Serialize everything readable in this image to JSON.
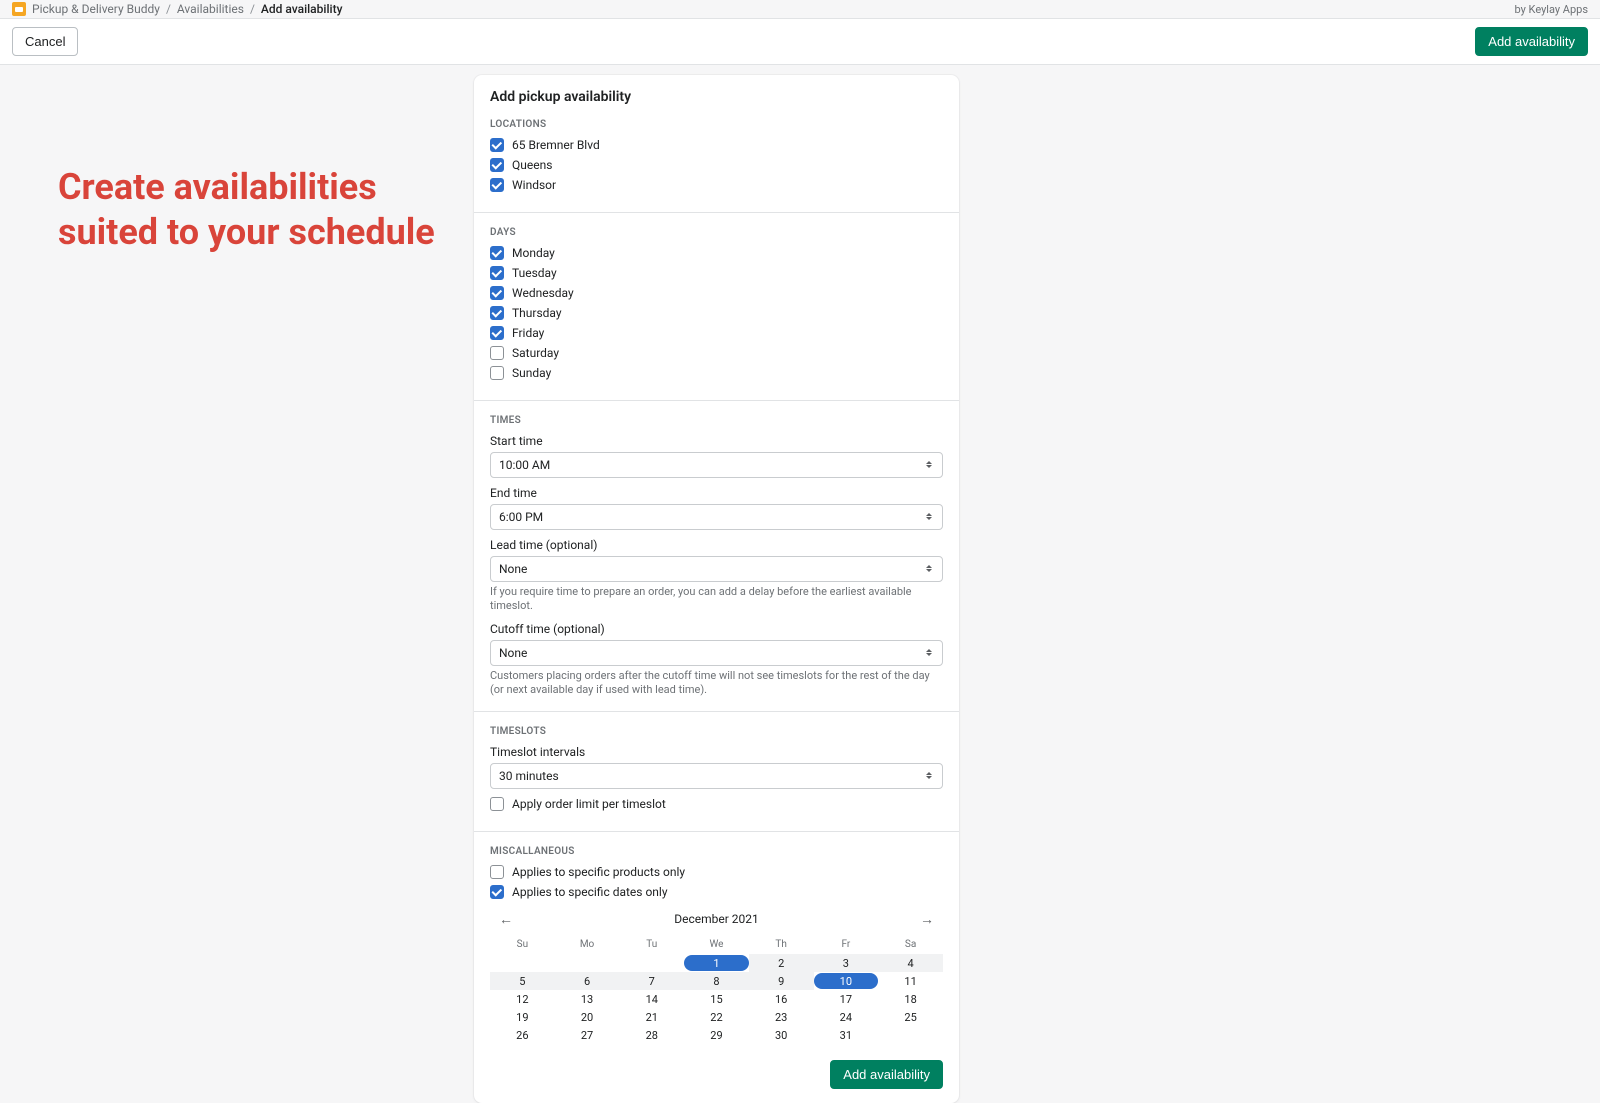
{
  "breadcrumb": {
    "app": "Pickup & Delivery Buddy",
    "mid": "Availabilities",
    "current": "Add availability"
  },
  "credit": "by Keylay Apps",
  "actionbar": {
    "cancel": "Cancel",
    "primary": "Add availability"
  },
  "headline": "Create availabilities suited to your schedule",
  "card": {
    "title": "Add pickup availability",
    "locations": {
      "label": "LOCATIONS",
      "items": [
        {
          "label": "65 Bremner Blvd",
          "checked": true
        },
        {
          "label": "Queens",
          "checked": true
        },
        {
          "label": "Windsor",
          "checked": true
        }
      ]
    },
    "days": {
      "label": "DAYS",
      "items": [
        {
          "label": "Monday",
          "checked": true
        },
        {
          "label": "Tuesday",
          "checked": true
        },
        {
          "label": "Wednesday",
          "checked": true
        },
        {
          "label": "Thursday",
          "checked": true
        },
        {
          "label": "Friday",
          "checked": true
        },
        {
          "label": "Saturday",
          "checked": false
        },
        {
          "label": "Sunday",
          "checked": false
        }
      ]
    },
    "times": {
      "label": "TIMES",
      "start_label": "Start time",
      "start_value": "10:00 AM",
      "end_label": "End time",
      "end_value": "6:00 PM",
      "lead_label": "Lead time (optional)",
      "lead_value": "None",
      "lead_help": "If you require time to prepare an order, you can add a delay before the earliest available timeslot.",
      "cutoff_label": "Cutoff time (optional)",
      "cutoff_value": "None",
      "cutoff_help": "Customers placing orders after the cutoff time will not see timeslots for the rest of the day (or next available day if used with lead time)."
    },
    "timeslots": {
      "label": "TIMESLOTS",
      "interval_label": "Timeslot intervals",
      "interval_value": "30 minutes",
      "limit_label": "Apply order limit per timeslot",
      "limit_checked": false
    },
    "misc": {
      "label": "MISCALLANEOUS",
      "products_label": "Applies to specific products only",
      "products_checked": false,
      "dates_label": "Applies to specific dates only",
      "dates_checked": true
    },
    "calendar": {
      "title": "December 2021",
      "dow": [
        "Su",
        "Mo",
        "Tu",
        "We",
        "Th",
        "Fr",
        "Sa"
      ],
      "weeks": [
        [
          "",
          "",
          "",
          "1",
          "2",
          "3",
          "4"
        ],
        [
          "5",
          "6",
          "7",
          "8",
          "9",
          "10",
          "11"
        ],
        [
          "12",
          "13",
          "14",
          "15",
          "16",
          "17",
          "18"
        ],
        [
          "19",
          "20",
          "21",
          "22",
          "23",
          "24",
          "25"
        ],
        [
          "26",
          "27",
          "28",
          "29",
          "30",
          "31",
          ""
        ]
      ]
    },
    "footer_button": "Add availability"
  }
}
